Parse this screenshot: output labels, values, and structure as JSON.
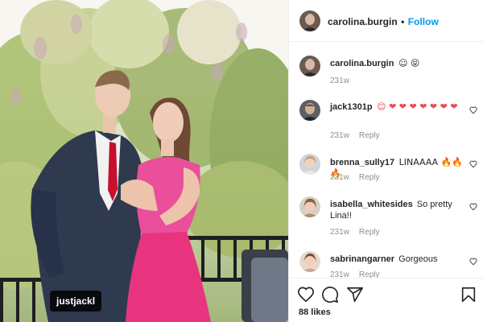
{
  "photo": {
    "tag_label": "justjackl"
  },
  "header": {
    "username": "carolina.burgin",
    "separator": "•",
    "follow_label": "Follow"
  },
  "caption": {
    "username": "carolina.burgin",
    "text": " ☺ 😝",
    "time": "231w"
  },
  "comments": [
    {
      "username": "jack1301p",
      "text": " 😊 ❤ ❤ ❤ ❤ ❤ ❤ ❤",
      "time": "231w",
      "reply_label": "Reply"
    },
    {
      "username": "brenna_sully17",
      "text": " LINAAAA 🔥🔥🔥",
      "time": "231w",
      "reply_label": "Reply"
    },
    {
      "username": "isabella_whitesides",
      "text": " So pretty Lina!!",
      "time": "231w",
      "reply_label": "Reply"
    },
    {
      "username": "sabrinangarner",
      "text": " Gorgeous",
      "time": "231w",
      "reply_label": "Reply"
    }
  ],
  "actions": {
    "icons": [
      "heart-icon",
      "comment-icon",
      "share-icon",
      "save-icon"
    ],
    "likes": "88 likes"
  },
  "colors": {
    "accent": "#0095f6",
    "heart_red": "#ed4956",
    "muted": "#8e8e8e"
  }
}
